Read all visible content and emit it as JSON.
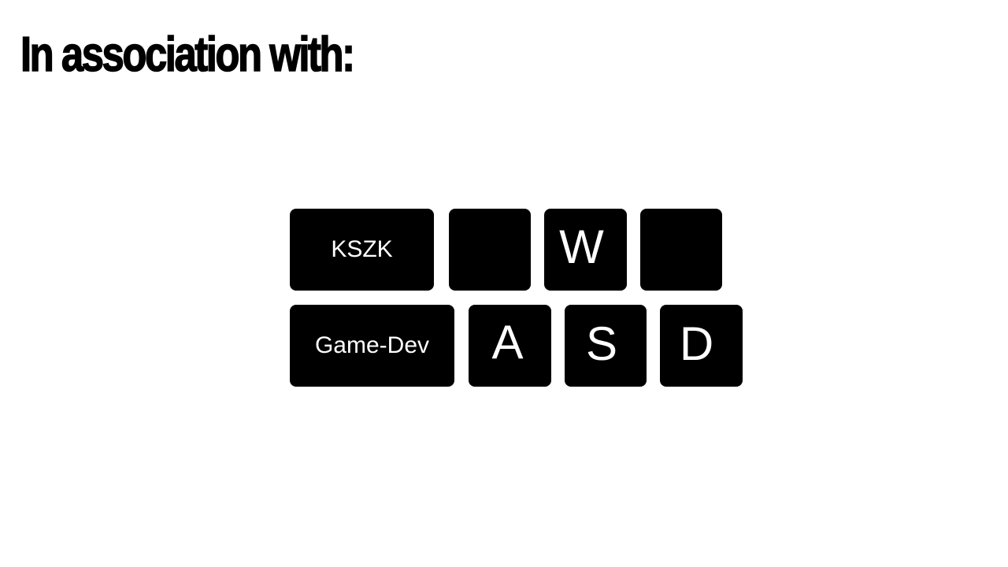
{
  "slide": {
    "title": "In association with:"
  },
  "keyboard": {
    "row1": {
      "kszk": "KSZK",
      "w": "W"
    },
    "row2": {
      "gamedev": "Game-Dev",
      "a": "A",
      "s": "S",
      "d": "D"
    }
  },
  "colors": {
    "background": "#ffffff",
    "key_fill": "#000000",
    "key_text": "#ffffff",
    "title_text": "#000000"
  }
}
